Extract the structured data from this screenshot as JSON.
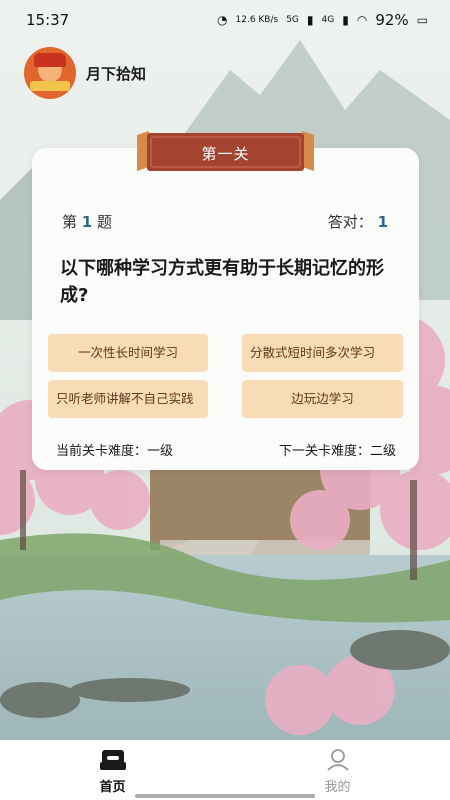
{
  "status": {
    "time": "15:37",
    "net_speed": "12.6 KB/s",
    "sig1": "5G",
    "sig2": "4G",
    "battery": "92%"
  },
  "header": {
    "app_name": "月下拾知"
  },
  "level": {
    "title": "第一关"
  },
  "quiz": {
    "q_prefix": "第",
    "q_number": "1",
    "q_suffix": "题",
    "correct_label": "答对：",
    "correct_count": "1",
    "question": "以下哪种学习方式更有助于长期记忆的形成?",
    "options": [
      "一次性长时间学习",
      "分散式短时间多次学习",
      "只听老师讲解不自己实践",
      "边玩边学习"
    ],
    "current_difficulty": "当前关卡难度：一级",
    "next_difficulty": "下一关卡难度：二级"
  },
  "nav": {
    "home": "首页",
    "mine": "我的"
  },
  "colors": {
    "accent": "#2b6a88",
    "option_bg": "#f8dcb8",
    "ribbon": "#a44330"
  }
}
